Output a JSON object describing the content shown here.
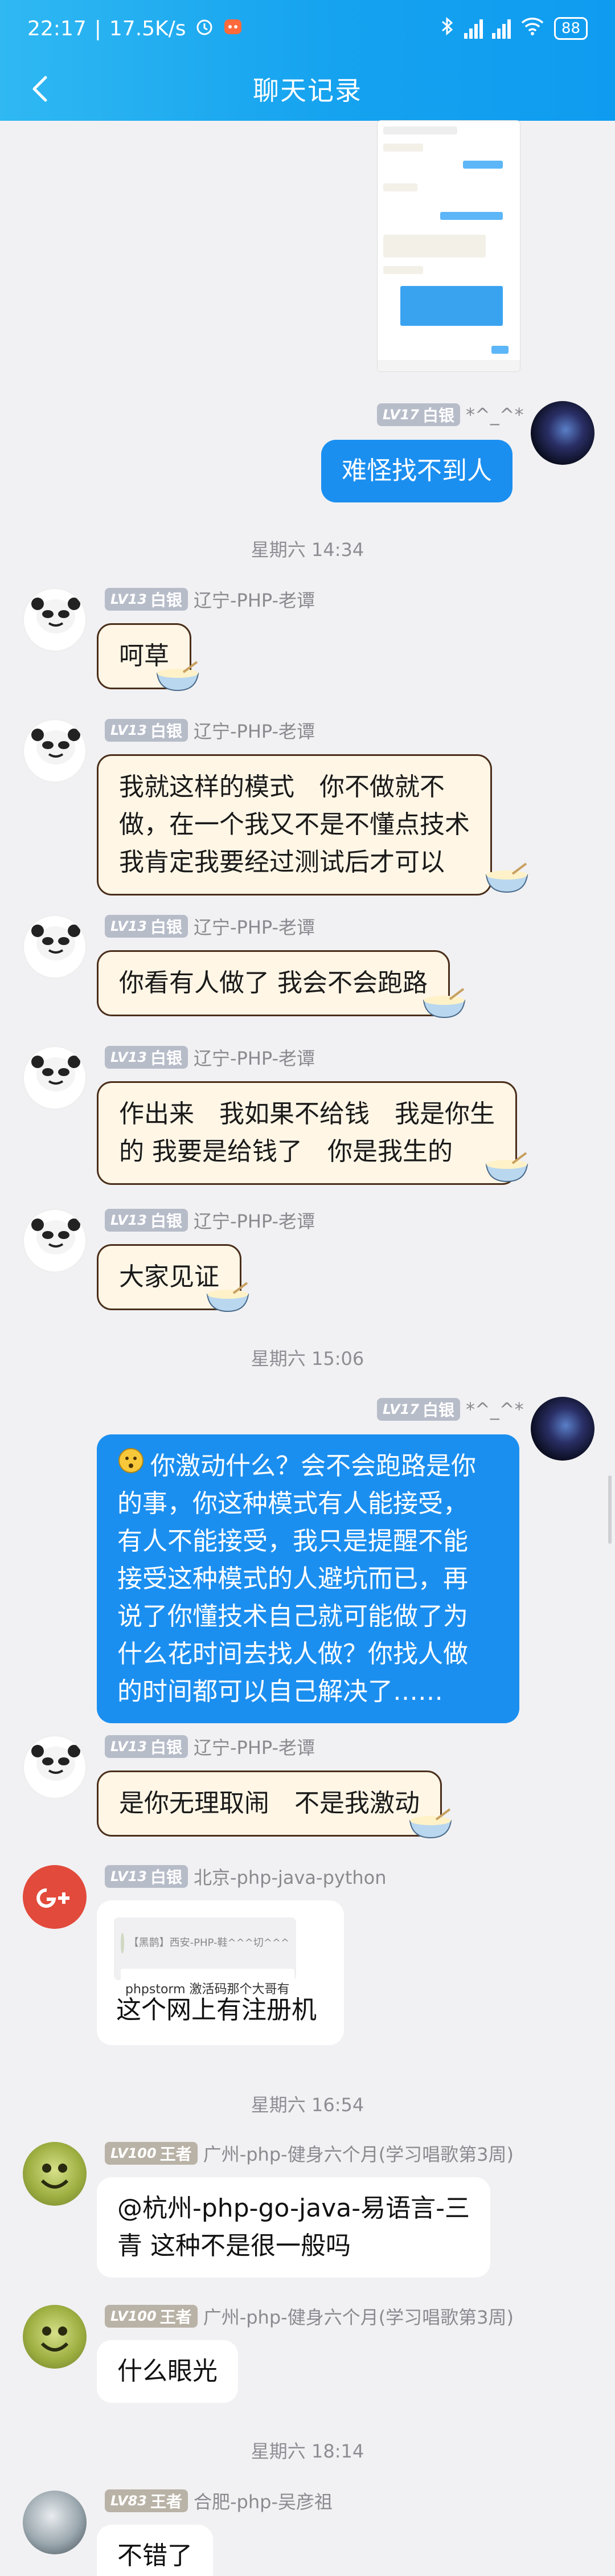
{
  "status": {
    "time": "22:17",
    "speed": "17.5K/s",
    "battery": "88"
  },
  "appbar": {
    "title": "聊天记录"
  },
  "messages": {
    "m1": {
      "level": "LV17",
      "rank": "白银",
      "name": "*^_^*",
      "text": "难怪找不到人"
    },
    "t1": "星期六 14:34",
    "m2": {
      "level": "LV13",
      "rank": "白银",
      "name": "辽宁-PHP-老谭",
      "text": "呵草"
    },
    "m3": {
      "level": "LV13",
      "rank": "白银",
      "name": "辽宁-PHP-老谭",
      "lines": [
        "我就这样的模式　你不做就不",
        "做，在一个我又不是不懂点技术",
        "我肯定我要经过测试后才可以"
      ]
    },
    "m4": {
      "level": "LV13",
      "rank": "白银",
      "name": "辽宁-PHP-老谭",
      "text": "你看有人做了 我会不会跑路"
    },
    "m5": {
      "level": "LV13",
      "rank": "白银",
      "name": "辽宁-PHP-老谭",
      "lines": [
        "作出来　我如果不给钱　我是你生",
        "的 我要是给钱了　你是我生的"
      ]
    },
    "m6": {
      "level": "LV13",
      "rank": "白银",
      "name": "辽宁-PHP-老谭",
      "text": "大家见证"
    },
    "t2": "星期六 15:06",
    "m7": {
      "level": "LV17",
      "rank": "白银",
      "name": "*^_^*",
      "lines": [
        "你激动什么？会不会跑路是你",
        "的事，你这种模式有人能接受，",
        "有人不能接受，我只是提醒不能",
        "接受这种模式的人避坑而已，再",
        "说了你懂技术自己就可能做了为",
        "什么花时间去找人做？你找人做",
        "的时间都可以自己解决了……"
      ]
    },
    "m8": {
      "level": "LV13",
      "rank": "白银",
      "name": "辽宁-PHP-老谭",
      "text": "是你无理取闹　不是我激动"
    },
    "m9": {
      "level": "LV13",
      "rank": "白银",
      "name": "北京-php-java-python",
      "quote_name": "【黑鹊】西安-PHP-鞋^^^切^^^",
      "quote_text": "phpstorm 激活码那个大哥有",
      "text": "这个网上有注册机"
    },
    "t3": "星期六 16:54",
    "m10": {
      "level": "LV100",
      "rank": "王者",
      "name": "广州-php-健身六个月(学习唱歌第3周)",
      "lines": [
        "@杭州-php-go-java-易语言-三",
        "青 这种不是很一般吗"
      ]
    },
    "m11": {
      "level": "LV100",
      "rank": "王者",
      "name": "广州-php-健身六个月(学习唱歌第3周)",
      "text": "什么眼光"
    },
    "t4": "星期六 18:14",
    "m12": {
      "level": "LV83",
      "rank": "王者",
      "name": "合肥-php-吴彦祖",
      "text": "不错了"
    }
  },
  "icons": {
    "back": "chevron-left-icon",
    "bluetooth": "bluetooth-icon",
    "wifi": "wifi-icon",
    "alarm": "alarm-icon"
  },
  "colors": {
    "accent": "#15a2ef",
    "self_bubble": "#1b8ff0",
    "other_bubble": "#fff6e6"
  }
}
